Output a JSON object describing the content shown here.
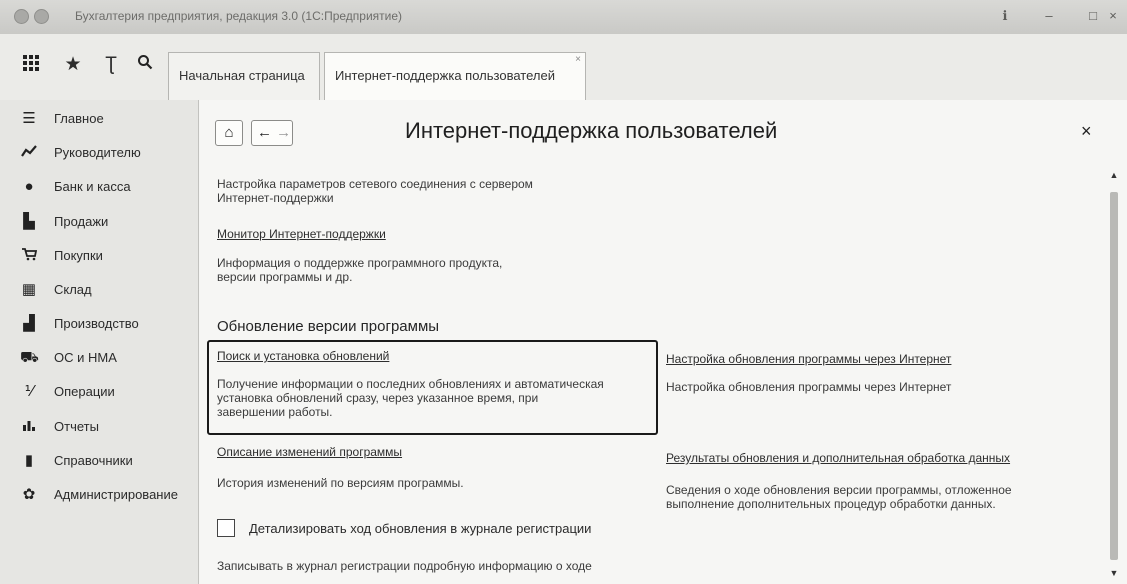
{
  "window": {
    "title": "Бухгалтерия предприятия, редакция 3.0 (1С:Предприятие)"
  },
  "tabs": [
    {
      "label": "Начальная страница"
    },
    {
      "label": "Интернет-поддержка пользователей"
    }
  ],
  "sidebar": {
    "items": [
      {
        "label": "Главное",
        "icon": "menu-icon"
      },
      {
        "label": "Руководителю",
        "icon": "trend-icon"
      },
      {
        "label": "Банк и касса",
        "icon": "coin-icon"
      },
      {
        "label": "Продажи",
        "icon": "bag-icon"
      },
      {
        "label": "Покупки",
        "icon": "cart-icon"
      },
      {
        "label": "Склад",
        "icon": "warehouse-icon"
      },
      {
        "label": "Производство",
        "icon": "factory-icon"
      },
      {
        "label": "ОС и НМА",
        "icon": "truck-icon"
      },
      {
        "label": "Операции",
        "icon": "percent-icon"
      },
      {
        "label": "Отчеты",
        "icon": "bar-chart-icon"
      },
      {
        "label": "Справочники",
        "icon": "book-icon"
      },
      {
        "label": "Администрирование",
        "icon": "gear-icon"
      }
    ]
  },
  "main": {
    "title": "Интернет-поддержка пользователей",
    "network_text_1": "Настройка параметров сетевого соединения с сервером",
    "network_text_2": "Интернет-поддержки",
    "monitor_link": "Монитор Интернет-поддержки",
    "monitor_text_1": "Информация о поддержке программного продукта,",
    "monitor_text_2": "версии программы и др.",
    "section_title": "Обновление версии программы",
    "search_link": "Поиск и установка обновлений",
    "search_text_1": "Получение информации о последних обновлениях и автоматическая",
    "search_text_2": "установка обновлений сразу, через указанное время, при",
    "search_text_3": "завершении работы.",
    "internet_update_link": "Настройка обновления программы через Интернет",
    "internet_update_text": "Настройка обновления программы через Интернет",
    "changes_link": "Описание изменений программы",
    "changes_text": "История изменений по версиям программы.",
    "results_link": "Результаты обновления и дополнительная обработка данных",
    "results_text_1": "Сведения о ходе обновления версии программы, отложенное",
    "results_text_2": "выполнение дополнительных процедур обработки данных.",
    "checkbox_label": "Детализировать ход обновления в журнале регистрации",
    "checkbox_checked": false,
    "log_text": "Записывать в журнал регистрации подробную информацию о ходе"
  },
  "icons": {
    "home": "home-icon",
    "back": "arrow-left-icon",
    "forward": "arrow-right-icon",
    "close": "close-icon"
  }
}
